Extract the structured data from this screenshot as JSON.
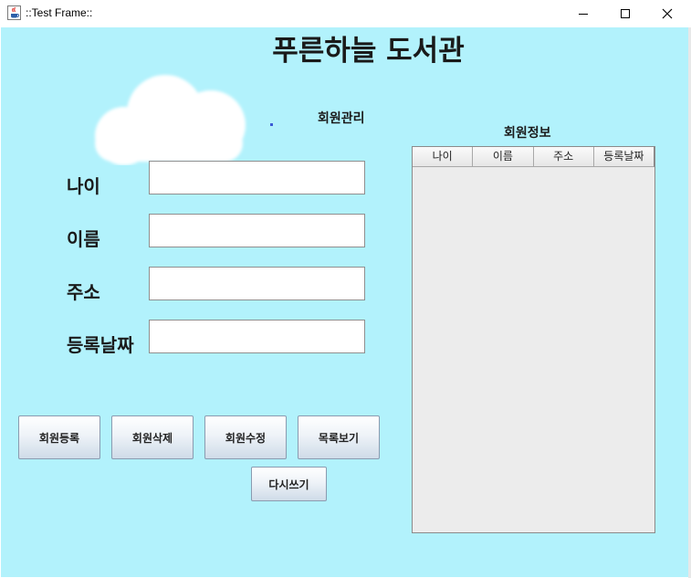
{
  "window": {
    "title": "::Test Frame::"
  },
  "app": {
    "main_title": "푸른하늘 도서관"
  },
  "form": {
    "section_label": "회원관리",
    "fields": [
      {
        "label": "나이",
        "value": ""
      },
      {
        "label": "이름",
        "value": ""
      },
      {
        "label": "주소",
        "value": ""
      },
      {
        "label": "등록날짜",
        "value": ""
      }
    ]
  },
  "table": {
    "caption": "회원정보",
    "columns": [
      "나이",
      "이름",
      "주소",
      "등록날짜"
    ],
    "rows": []
  },
  "buttons": {
    "register": "회원등록",
    "delete": "회원삭제",
    "edit": "회원수정",
    "list": "목록보기",
    "rewrite": "다시쓰기"
  },
  "colors": {
    "background": "#b2f2fc"
  },
  "icons": {
    "app": "java-coffee-icon",
    "minimize": "minimize-icon",
    "maximize": "maximize-icon",
    "close": "close-icon"
  }
}
